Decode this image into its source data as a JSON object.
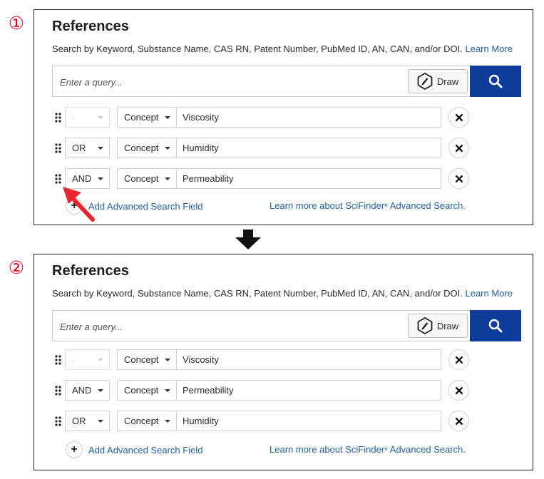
{
  "steps": [
    {
      "number": "①",
      "title": "References",
      "subtitle": "Search by Keyword, Substance Name, CAS RN, Patent Number, PubMed ID, AN, CAN, and/or DOI.",
      "learn_more": "Learn More",
      "query_placeholder": "Enter a query...",
      "draw_label": "Draw",
      "rows": [
        {
          "operator": "-",
          "concept": "Concept",
          "term": "Viscosity"
        },
        {
          "operator": "OR",
          "concept": "Concept",
          "term": "Humidity"
        },
        {
          "operator": "AND",
          "concept": "Concept",
          "term": "Permeability"
        }
      ],
      "add_field_label": "Add Advanced Search Field",
      "learn_advanced_label": "Learn more about SciFinderⁿ Advanced Search."
    },
    {
      "number": "②",
      "title": "References",
      "subtitle": "Search by Keyword, Substance Name, CAS RN, Patent Number, PubMed ID, AN, CAN, and/or DOI.",
      "learn_more": "Learn More",
      "query_placeholder": "Enter a query...",
      "draw_label": "Draw",
      "rows": [
        {
          "operator": "-",
          "concept": "Concept",
          "term": "Viscosity"
        },
        {
          "operator": "AND",
          "concept": "Concept",
          "term": "Permeability"
        },
        {
          "operator": "OR",
          "concept": "Concept",
          "term": "Humidity"
        }
      ],
      "add_field_label": "Add Advanced Search Field",
      "learn_advanced_label": "Learn more about SciFinderⁿ Advanced Search."
    }
  ],
  "colors": {
    "step_number": "#e5001a",
    "search_button": "#0d3c9b",
    "link": "#1f5fa8",
    "annotation_arrow": "#e8262d"
  },
  "icons": {
    "search": "search-icon",
    "draw": "hexagon-pencil-icon",
    "remove": "close-icon",
    "drag": "drag-handle-icon",
    "add": "plus-icon",
    "transition": "arrow-down-icon",
    "annotation": "red-pointer-arrow-icon"
  }
}
